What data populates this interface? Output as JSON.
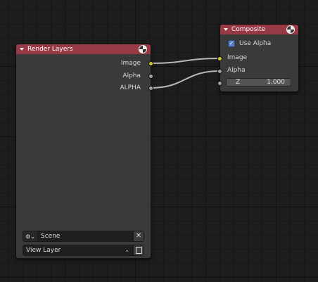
{
  "render_layers": {
    "title": "Render Layers",
    "outputs": [
      {
        "label": "Image",
        "color": "#c7c729"
      },
      {
        "label": "Alpha",
        "color": "#a1a1a1"
      },
      {
        "label": "ALPHA",
        "color": "#a1a1a1"
      }
    ],
    "scene": {
      "value": "Scene",
      "clear_symbol": "✕",
      "icon": "scene-data-icon"
    },
    "view_layer": {
      "value": "View Layer",
      "chevron": "⌄"
    }
  },
  "composite": {
    "title": "Composite",
    "use_alpha": {
      "label": "Use Alpha",
      "checked": true,
      "check_symbol": "✓"
    },
    "inputs": [
      {
        "label": "Image",
        "color": "#c7c729"
      },
      {
        "label": "Alpha",
        "color": "#a1a1a1"
      }
    ],
    "z_field": {
      "label": "Z",
      "value": "1.000"
    }
  },
  "header_color": "#973a45"
}
